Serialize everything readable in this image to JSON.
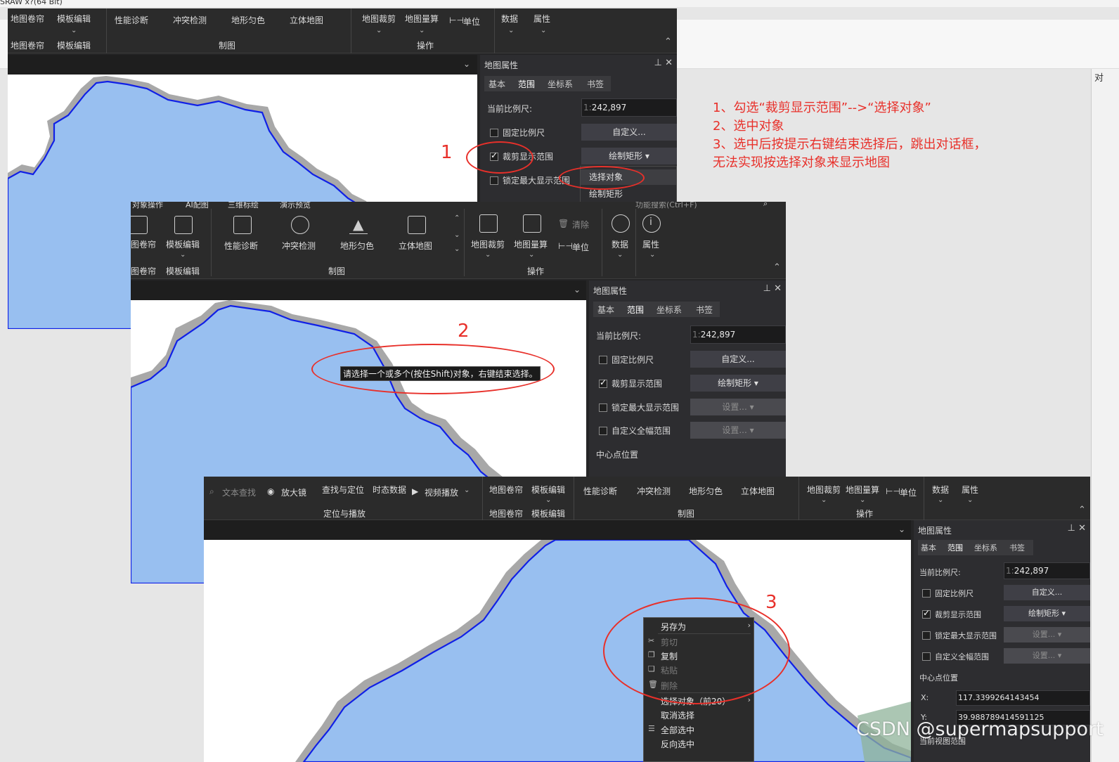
{
  "app_title": "SRAW x?(64 Bit)",
  "side_tab": "对",
  "ribbon_top": {
    "map_curtain": "地图卷帘",
    "template_edit": "模板编辑",
    "perf_diag": "性能诊断",
    "conflict_check": "冲突检测",
    "terrain_color": "地形匀色",
    "map_3d": "立体地图",
    "map_clip": "地图裁剪",
    "map_measure": "地图量算",
    "unit": "单位",
    "data": "数据",
    "attributes": "属性",
    "group_curtain": "地图卷帘",
    "group_template": "模板编辑",
    "group_mapping": "制图",
    "group_operation": "操作"
  },
  "ribbon_mid": {
    "top_tabs": [
      "对象操作",
      "AI配图",
      "三维标绘",
      "演示预览"
    ],
    "search_placeholder": "功能搜索(Ctrl+F)",
    "clear": "清除",
    "curtain_partial": "图卷帘",
    "group_curtain_partial": "图卷帘"
  },
  "ribbon_bottom": {
    "text_search": "文本查找",
    "magnifier": "放大镜",
    "find_locate": "查找与定位",
    "temporal_data": "时态数据",
    "video_play": "视频播放",
    "group_locate_play": "定位与播放"
  },
  "panel": {
    "title": "地图属性",
    "pin": "📌",
    "close": "✕",
    "tabs": [
      "基本",
      "范围",
      "坐标系",
      "书签"
    ],
    "current_scale_label": "当前比例尺:",
    "scale_prefix": "1:",
    "scale_value": "242,897",
    "fixed_scale": "固定比例尺",
    "custom_btn": "自定义...",
    "clip_display": "裁剪显示范围",
    "draw_rect": "绘制矩形",
    "lock_max": "锁定最大显示范围",
    "lock_max_partial": "锁定最大显示范围",
    "custom_full": "自定义全幅范围",
    "custom_full_partial": "自定义全幅范围",
    "settings_btn": "设置...",
    "center_label": "中心点位置",
    "x_label": "X:",
    "x_value": "117.3399264143454",
    "y_label": "Y:",
    "y_value": "39.988789414591125",
    "view_range": "当前视图范围"
  },
  "dropdown": {
    "select_object": "选择对象",
    "draw_rect": "绘制矩形"
  },
  "tooltip": "请选择一个或多个(按住Shift)对象，右键结束选择。",
  "context_menu": {
    "save_as": "另存为",
    "cut": "剪切",
    "copy": "复制",
    "paste": "粘贴",
    "delete": "删除",
    "select_object": "选择对象（前20）",
    "deselect": "取消选择",
    "select_all": "全部选中",
    "invert": "反向选中"
  },
  "annotations": {
    "line1": "1、勾选“裁剪显示范围”-->“选择对象”",
    "line2": "2、选中对象",
    "line3": "3、选中后按提示右键结束选择后，跳出对话框，",
    "line4": "无法实现按选择对象来显示地图",
    "num1": "1",
    "num2": "2",
    "num3": "3"
  },
  "watermark": "CSDN @supermapsupport",
  "colors": {
    "annotation_red": "#e8302a",
    "map_fill": "#98bff0",
    "boundary_blue": "#1020e6",
    "buffer_gray": "#a8a8a8",
    "ui_dark": "#252526"
  }
}
